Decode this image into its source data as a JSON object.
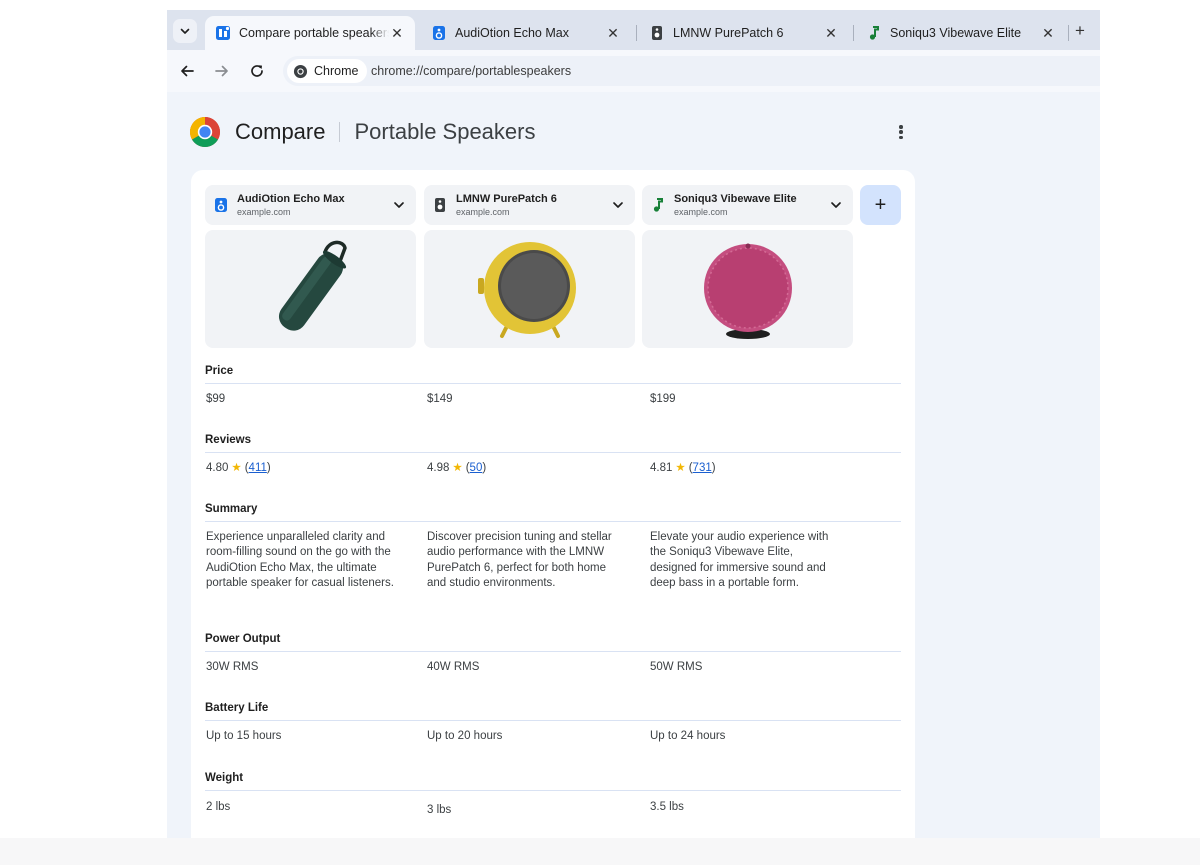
{
  "tabs": [
    {
      "title": "Compare portable speakers",
      "active": true
    },
    {
      "title": "AudiOtion Echo Max",
      "active": false
    },
    {
      "title": "LMNW PurePatch 6",
      "active": false
    },
    {
      "title": "Soniqu3 Vibewave Elite",
      "active": false
    }
  ],
  "toolbar": {
    "chip_label": "Chrome",
    "url": "chrome://compare/portablespeakers"
  },
  "page": {
    "title": "Compare",
    "subtitle": "Portable Speakers"
  },
  "products": [
    {
      "name": "AudiOtion Echo Max",
      "domain": "example.com",
      "icon": "speaker-box-icon",
      "color": "#25483f"
    },
    {
      "name": "LMNW PurePatch 6",
      "domain": "example.com",
      "icon": "speaker-icon",
      "color": "#e2c436"
    },
    {
      "name": "Soniqu3 Vibewave Elite",
      "domain": "example.com",
      "icon": "music-note-icon",
      "color": "#c44d7f"
    }
  ],
  "attributes": {
    "price": {
      "label": "Price",
      "values": [
        "$99",
        "$149",
        "$199"
      ]
    },
    "reviews": {
      "label": "Reviews",
      "values": [
        {
          "rating": "4.80",
          "count": "411"
        },
        {
          "rating": "4.98",
          "count": "50"
        },
        {
          "rating": "4.81",
          "count": "731"
        }
      ]
    },
    "summary": {
      "label": "Summary",
      "values": [
        "Experience unparalleled clarity and room-filling sound on the go with the AudiOtion Echo Max, the ultimate portable speaker for casual listeners.",
        "Discover precision tuning and stellar audio performance with the LMNW PurePatch 6, perfect for both home and studio environments.",
        "Elevate your audio experience with the Soniqu3 Vibewave Elite, designed for immersive sound and deep bass in a portable form."
      ]
    },
    "power_output": {
      "label": "Power Output",
      "values": [
        "30W RMS",
        "40W RMS",
        "50W RMS"
      ]
    },
    "battery_life": {
      "label": "Battery Life",
      "values": [
        "Up to 15 hours",
        "Up to 20 hours",
        "Up to 24 hours"
      ]
    },
    "weight": {
      "label": "Weight",
      "values": [
        "2 lbs",
        "3 lbs",
        "3.5 lbs"
      ]
    }
  },
  "colors": {
    "tabstrip": "#dde3ee",
    "page_background": "#f0f4fa",
    "add_button": "#d3e3fd",
    "link": "#1a5fd0",
    "star": "#f2b705"
  }
}
